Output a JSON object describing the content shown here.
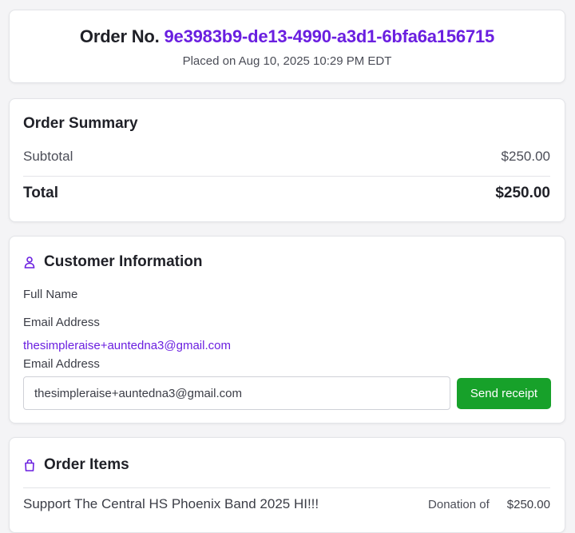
{
  "order": {
    "label": "Order No.",
    "id": "9e3983b9-de13-4990-a3d1-6bfa6a156715",
    "placed": "Placed on Aug 10, 2025 10:29 PM EDT"
  },
  "summary": {
    "title": "Order Summary",
    "subtotal_label": "Subtotal",
    "subtotal_value": "$250.00",
    "total_label": "Total",
    "total_value": "$250.00"
  },
  "customer": {
    "title": "Customer Information",
    "icon": "user-icon",
    "full_name_label": "Full Name",
    "email_label": "Email Address",
    "email_value": "thesimpleraise+auntedna3@gmail.com",
    "email_input_label": "Email Address",
    "email_input_value": "thesimpleraise+auntedna3@gmail.com",
    "send_button": "Send receipt"
  },
  "items": {
    "title": "Order Items",
    "icon": "shopping-bag-icon",
    "list": [
      {
        "name": "Support The Central HS Phoenix Band 2025 HI!!!",
        "type": "Donation of",
        "price": "$250.00"
      }
    ]
  },
  "colors": {
    "accent": "#6a1fe0",
    "button": "#17a12a"
  }
}
